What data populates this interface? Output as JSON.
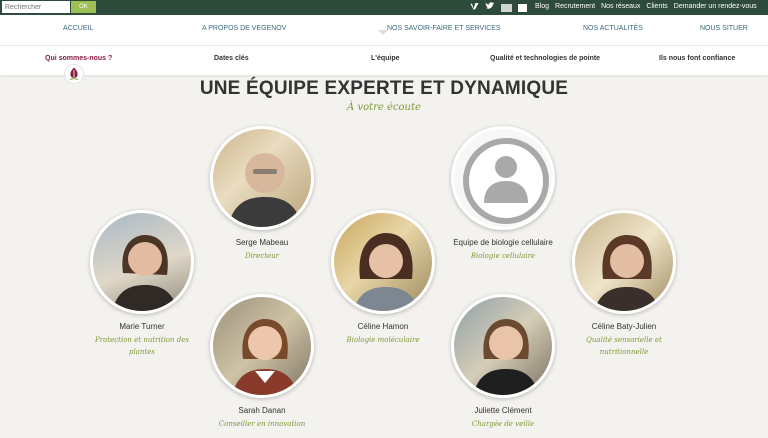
{
  "search": {
    "placeholder": "Rechercher",
    "button_label": "OK"
  },
  "topbar": {
    "icons": [
      "vimeo-icon",
      "twitter-icon",
      "social-icon",
      "social-icon"
    ],
    "links": [
      "Blog",
      "Recrutement",
      "Nos réseaux",
      "Clients",
      "Demander un rendez-vous"
    ]
  },
  "mainnav": {
    "items": [
      "Accueil",
      "A propos de Vegenov",
      "Nos savoir-faire et services",
      "Nos actualités",
      "Nous situer"
    ]
  },
  "subnav": {
    "items": [
      "Qui sommes-nous ?",
      "Dates clés",
      "L'équipe",
      "Qualité et technologies de pointe",
      "Ils nous font confiance"
    ],
    "active_index": 0
  },
  "page": {
    "title": "UNE ÉQUIPE EXPERTE ET DYNAMIQUE",
    "subtitle": "À votre écoute"
  },
  "team": [
    {
      "name": "Serge Mabeau",
      "role": "Directeur"
    },
    {
      "name": "Equipe de biologie cellulaire",
      "role": "Biologie cellulaire"
    },
    {
      "name": "Marie Turner",
      "role": "Protection et nutrition des plantes"
    },
    {
      "name": "Céline Hamon",
      "role": "Biologie moléculaire"
    },
    {
      "name": "Céline Baty-Julien",
      "role": "Qualité sensorielle et nutritionnelle"
    },
    {
      "name": "Sarah Danan",
      "role": "Conseiller en innovation"
    },
    {
      "name": "Juliette Clément",
      "role": "Chargée de veille"
    }
  ],
  "colors": {
    "topbar": "#2e4a3a",
    "accent_green": "#7c9a3a",
    "active_nav": "#8a1c3c",
    "nav_link": "#3a6a7a"
  }
}
